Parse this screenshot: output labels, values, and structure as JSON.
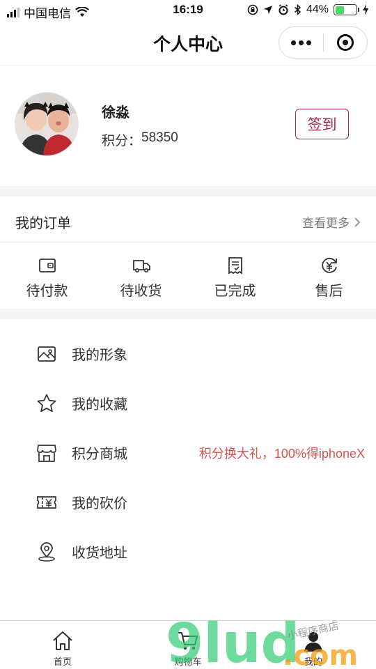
{
  "status_bar": {
    "carrier": "中国电信",
    "time": "16:19",
    "battery": "44%",
    "battery_level": 0.44
  },
  "nav": {
    "title": "个人中心"
  },
  "profile": {
    "name": "徐淼",
    "points_label": "积分：",
    "points_value": "58350",
    "checkin_label": "签到"
  },
  "orders": {
    "title": "我的订单",
    "more": "查看更多",
    "tabs": [
      {
        "label": "待付款",
        "icon": "wallet-icon"
      },
      {
        "label": "待收货",
        "icon": "truck-icon"
      },
      {
        "label": "已完成",
        "icon": "receipt-icon"
      },
      {
        "label": "售后",
        "icon": "refund-icon"
      }
    ]
  },
  "menu": [
    {
      "label": "我的形象",
      "icon": "image-icon"
    },
    {
      "label": "我的收藏",
      "icon": "star-icon"
    },
    {
      "label": "积分商城",
      "icon": "store-icon",
      "promo": "积分换大礼，100%得iphoneX"
    },
    {
      "label": "我的砍价",
      "icon": "ticket-icon"
    },
    {
      "label": "收货地址",
      "icon": "location-icon"
    }
  ],
  "tabbar": [
    {
      "label": "首页",
      "icon": "home-icon"
    },
    {
      "label": "购物车",
      "icon": "cart-icon"
    },
    {
      "label": "我的",
      "icon": "user-icon"
    }
  ],
  "watermark": {
    "text_main": "9lud",
    "text_sub": ".com",
    "text_small": "小程序商店"
  },
  "colors": {
    "accent": "#a3284a",
    "promo": "#d9534f",
    "section_gap": "#f4f4f4"
  }
}
